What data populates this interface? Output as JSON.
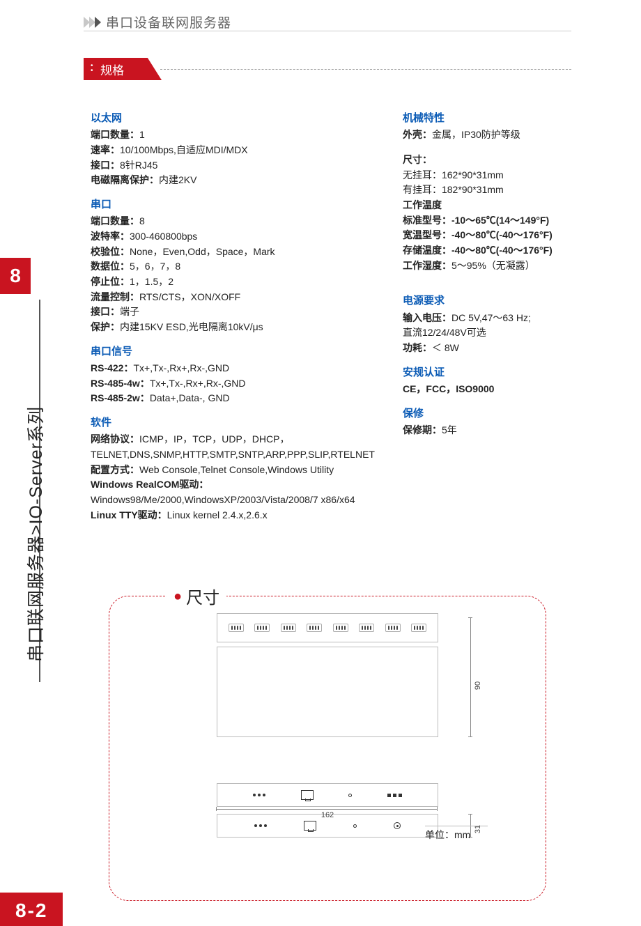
{
  "header": {
    "top_title": "串口设备联网服务器",
    "spec_title": "规格"
  },
  "sidebar": {
    "chapter_num": "8",
    "side_label": "串口联网服务器>IO-Server系列",
    "page_num": "8-2"
  },
  "left": {
    "ethernet": {
      "title": "以太网",
      "ports_label": "端口数量：",
      "ports_value": "1",
      "speed_label": "速率：",
      "speed_value": "10/100Mbps,自适应MDI/MDX",
      "iface_label": "接口：",
      "iface_value": "8针RJ45",
      "iso_label": "电磁隔离保护：",
      "iso_value": "内建2KV"
    },
    "serial": {
      "title": "串口",
      "ports_label": "端口数量：",
      "ports_value": "8",
      "baud_label": "波特率：",
      "baud_value": "300-460800bps",
      "parity_label": "校验位：",
      "parity_value": "None，Even,Odd，Space，Mark",
      "data_label": "数据位：",
      "data_value": "5，6，7，8",
      "stop_label": "停止位：",
      "stop_value": "1，1.5，2",
      "flow_label": "流量控制：",
      "flow_value": "RTS/CTS，XON/XOFF",
      "iface_label": "接口：",
      "iface_value": "端子",
      "protect_label": "保护：",
      "protect_value": "内建15KV ESD,光电隔离10kV/μs"
    },
    "signal": {
      "title": "串口信号",
      "rs422_label": "RS-422：",
      "rs422_value": "Tx+,Tx-,Rx+,Rx-,GND",
      "rs485_4w_label": "RS-485-4w：",
      "rs485_4w_value": "Tx+,Tx-,Rx+,Rx-,GND",
      "rs485_2w_label": "RS-485-2w：",
      "rs485_2w_value": "Data+,Data-, GND"
    },
    "software": {
      "title": "软件",
      "proto_label": "网络协议：",
      "proto_value": "ICMP，IP，TCP，UDP，DHCP，",
      "proto_value2": "TELNET,DNS,SNMP,HTTP,SMTP,SNTP,ARP,PPP,SLIP,RTELNET",
      "cfg_label": "配置方式：",
      "cfg_value": "Web Console,Telnet Console,Windows Utility",
      "win_label": "Windows RealCOM驱动：",
      "win_value": "Windows98/Me/2000,WindowsXP/2003/Vista/2008/7 x86/x64",
      "linux_label": "Linux TTY驱动：",
      "linux_value": "Linux kernel 2.4.x,2.6.x"
    }
  },
  "right": {
    "mech": {
      "title": "机械特性",
      "shell_label": "外壳：",
      "shell_value": "金属，IP30防护等级"
    },
    "size": {
      "title": "尺寸：",
      "no_ear": "无挂耳：162*90*31mm",
      "with_ear": "有挂耳：182*90*31mm",
      "temp_title": "工作温度",
      "std_label": "标准型号：",
      "std_value": "-10～65℃(14～149°F)",
      "wide_label": "宽温型号：",
      "wide_value": "-40～80℃(-40～176°F)",
      "store_label": "存储温度：",
      "store_value": "-40～80℃(-40～176°F)",
      "humid_label": "工作湿度：",
      "humid_value": "5～95%（无凝露）"
    },
    "power": {
      "title": "电源要求",
      "vin_label": "输入电压：",
      "vin_value": "DC 5V,47～63 Hz;",
      "vin_value2": "直流12/24/48V可选",
      "cons_label": "功耗：",
      "cons_value": "＜ 8W"
    },
    "cert": {
      "title": "安规认证",
      "value": "CE，FCC，ISO9000"
    },
    "warranty": {
      "title": "保修",
      "label": "保修期：",
      "value": "5年"
    }
  },
  "diagram": {
    "title": "尺寸",
    "dim_90": "90",
    "dim_31": "31",
    "dim_162": "162",
    "unit": "单位：mm"
  }
}
